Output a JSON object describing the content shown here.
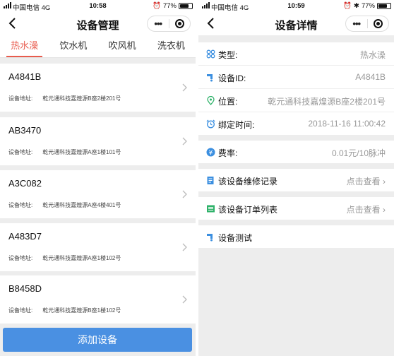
{
  "left": {
    "status": {
      "carrier": "中国电信  4G",
      "time": "10:58",
      "battery": "77%"
    },
    "nav": {
      "title": "设备管理"
    },
    "tabs": [
      "热水澡",
      "饮水机",
      "吹风机",
      "洗衣机"
    ],
    "active_tab": "热水澡",
    "devices": [
      {
        "id": "A4841B",
        "addr_label": "设备地址:",
        "addr": "乾元通科技嘉煌源B座2楼201号"
      },
      {
        "id": "AB3470",
        "addr_label": "设备地址:",
        "addr": "乾元通科技嘉煌源A座1楼101号"
      },
      {
        "id": "A3C082",
        "addr_label": "设备地址:",
        "addr": "乾元通科技嘉煌源A座4楼401号"
      },
      {
        "id": "A483D7",
        "addr_label": "设备地址:",
        "addr": "乾元通科技嘉煌源A座1楼102号"
      },
      {
        "id": "B8458D",
        "addr_label": "设备地址:",
        "addr": "乾元通科技嘉煌源B座1楼102号"
      }
    ],
    "add_button": "添加设备"
  },
  "right": {
    "status": {
      "carrier": "中国电信  4G",
      "time": "10:59",
      "battery": "77%"
    },
    "nav": {
      "title": "设备详情"
    },
    "info": [
      {
        "label": "类型:",
        "value": "热水澡",
        "icon": "category-icon"
      },
      {
        "label": "设备ID:",
        "value": "A4841B",
        "icon": "water-tap-icon"
      },
      {
        "label": "位置:",
        "value": "乾元通科技嘉煌源B座2楼201号",
        "icon": "location-pin-icon"
      },
      {
        "label": "绑定时间:",
        "value": "2018-11-16 11:00:42",
        "icon": "alarm-clock-icon"
      }
    ],
    "rate": {
      "label": "费率:",
      "value": "0.01元/10脉冲",
      "icon": "yen-coin-icon"
    },
    "repair": {
      "label": "该设备维修记录",
      "value": "点击查看",
      "icon": "notepad-icon"
    },
    "orders": {
      "label": "该设备订单列表",
      "value": "点击查看",
      "icon": "list-icon"
    },
    "test": {
      "label": "设备测试",
      "icon": "water-tap-icon"
    },
    "colors": {
      "accent": "#e85b4d",
      "primary_button": "#4a90e2",
      "icon_blue": "#3b8fe0",
      "icon_green": "#2fb26a"
    }
  }
}
